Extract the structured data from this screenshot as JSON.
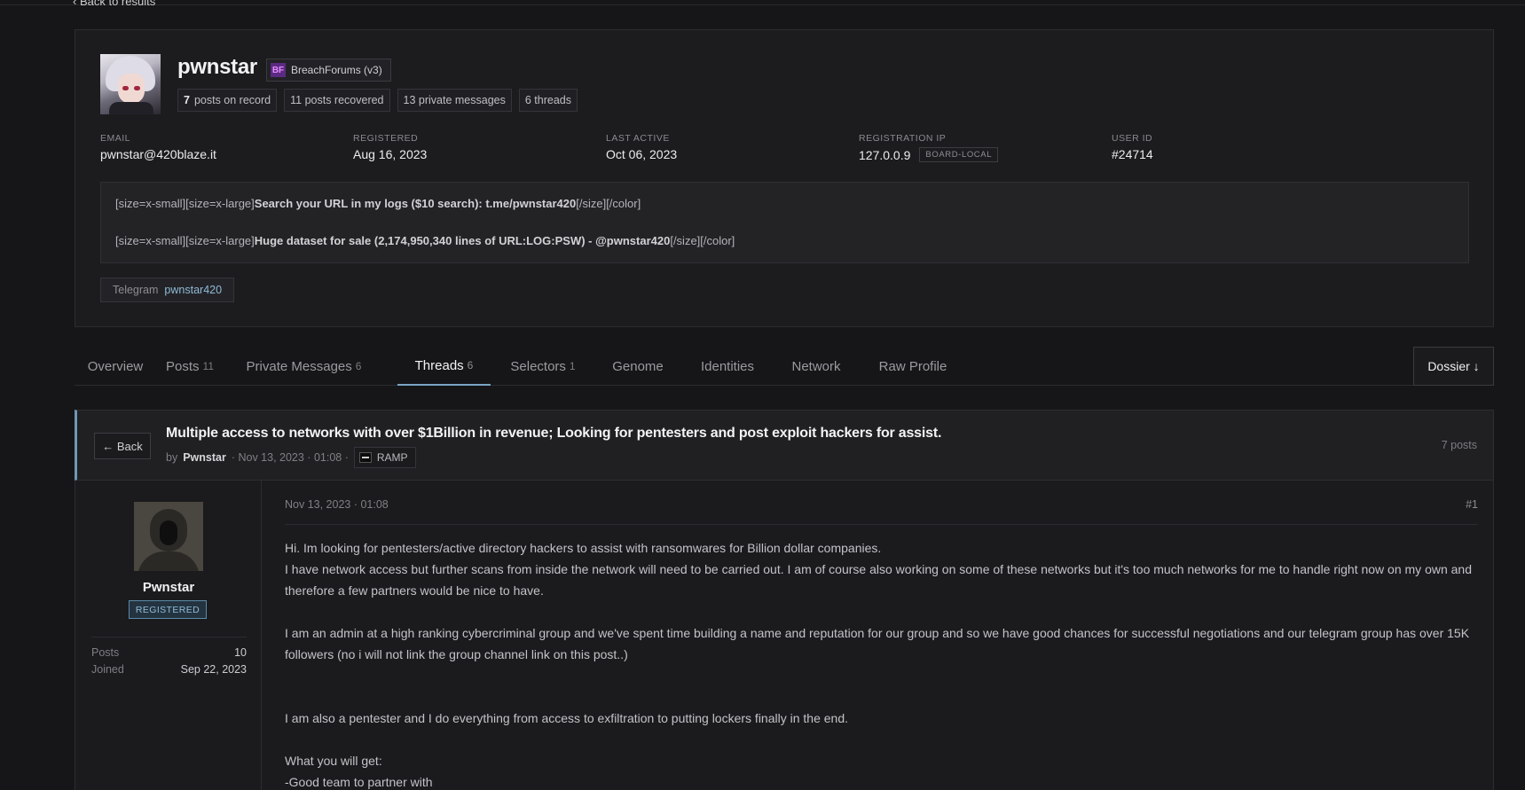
{
  "nav": {
    "back_to_results": "‹ Back to results"
  },
  "profile": {
    "username": "pwnstar",
    "forum_badge": {
      "icon": "BF",
      "label": "BreachForums (v3)"
    },
    "stats": [
      {
        "num": "7",
        "label": "posts on record"
      },
      {
        "num": "",
        "label": "11 posts recovered"
      },
      {
        "num": "",
        "label": "13 private messages"
      },
      {
        "num": "",
        "label": "6 threads"
      }
    ],
    "fields": [
      {
        "label": "EMAIL",
        "value": "pwnstar@420blaze.it"
      },
      {
        "label": "REGISTERED",
        "value": "Aug 16, 2023"
      },
      {
        "label": "LAST ACTIVE",
        "value": "Oct 06, 2023"
      },
      {
        "label": "REGISTRATION IP",
        "value": "127.0.0.9",
        "tag": "BOARD-LOCAL"
      },
      {
        "label": "USER ID",
        "value": "#24714"
      }
    ],
    "signature": [
      {
        "pre": "[size=x-small][size=x-large]",
        "bold": "Search your URL in my logs ($10 search): t.me/pwnstar420",
        "post": "[/size][/color]"
      },
      {
        "pre": "[size=x-small][size=x-large]",
        "bold": "Huge dataset for sale (2,174,950,340 lines of URL:LOG:PSW) - @pwnstar420",
        "post": "[/size][/color]"
      }
    ],
    "telegram": {
      "key": "Telegram",
      "value": "pwnstar420"
    }
  },
  "tabs": [
    {
      "label": "Overview",
      "count": ""
    },
    {
      "label": "Posts",
      "count": "11"
    },
    {
      "label": "Private Messages",
      "count": "6"
    },
    {
      "label": "Threads",
      "count": "6",
      "active": true
    },
    {
      "label": "Selectors",
      "count": "1"
    },
    {
      "label": "Genome",
      "count": ""
    },
    {
      "label": "Identities",
      "count": ""
    },
    {
      "label": "Network",
      "count": ""
    },
    {
      "label": "Raw Profile",
      "count": ""
    }
  ],
  "dossier_button": "Dossier ↓",
  "thread": {
    "back_label": "← Back",
    "title": "Multiple access to networks with over $1Billion in revenue; Looking for pentesters and post exploit hackers for assist.",
    "by": "by",
    "author": "Pwnstar",
    "date": "· Nov 13, 2023 · 01:08 ·",
    "forum": "RAMP",
    "post_count": "7 posts"
  },
  "post": {
    "author": "Pwnstar",
    "role": "REGISTERED",
    "info": [
      {
        "k": "Posts",
        "v": "10"
      },
      {
        "k": "Joined",
        "v": "Sep 22, 2023"
      }
    ],
    "timestamp": "Nov 13, 2023 · 01:08",
    "number": "#1",
    "lines": [
      "Hi. Im looking for pentesters/active directory hackers to assist with ransomwares for Billion dollar companies.",
      "I have network access but further scans from inside the network will need to be carried out. I am of course also working on some of these networks but it's too much networks for me to handle right now on my own and therefore a few partners would be nice to have.",
      "I am an admin at a high ranking cybercriminal group and we've spent time building a name and reputation for our group and so we have good chances for successful negotiations and our telegram group has over 15K followers (no i will not link the group channel link on this post..)",
      "I am also a pentester and I do everything from access to exfiltration to putting lockers finally in the end.",
      "What you will get:",
      "-Good team to partner with"
    ]
  }
}
